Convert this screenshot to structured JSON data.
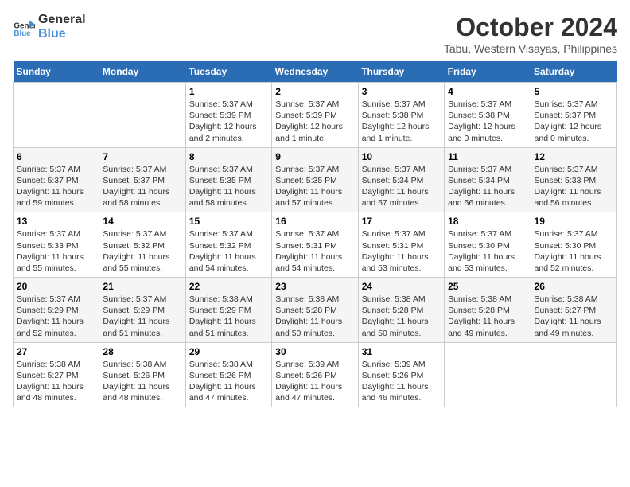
{
  "header": {
    "logo_line1": "General",
    "logo_line2": "Blue",
    "month": "October 2024",
    "location": "Tabu, Western Visayas, Philippines"
  },
  "weekdays": [
    "Sunday",
    "Monday",
    "Tuesday",
    "Wednesday",
    "Thursday",
    "Friday",
    "Saturday"
  ],
  "weeks": [
    [
      {
        "day": "",
        "info": ""
      },
      {
        "day": "",
        "info": ""
      },
      {
        "day": "1",
        "info": "Sunrise: 5:37 AM\nSunset: 5:39 PM\nDaylight: 12 hours and 2 minutes."
      },
      {
        "day": "2",
        "info": "Sunrise: 5:37 AM\nSunset: 5:39 PM\nDaylight: 12 hours and 1 minute."
      },
      {
        "day": "3",
        "info": "Sunrise: 5:37 AM\nSunset: 5:38 PM\nDaylight: 12 hours and 1 minute."
      },
      {
        "day": "4",
        "info": "Sunrise: 5:37 AM\nSunset: 5:38 PM\nDaylight: 12 hours and 0 minutes."
      },
      {
        "day": "5",
        "info": "Sunrise: 5:37 AM\nSunset: 5:37 PM\nDaylight: 12 hours and 0 minutes."
      }
    ],
    [
      {
        "day": "6",
        "info": "Sunrise: 5:37 AM\nSunset: 5:37 PM\nDaylight: 11 hours and 59 minutes."
      },
      {
        "day": "7",
        "info": "Sunrise: 5:37 AM\nSunset: 5:37 PM\nDaylight: 11 hours and 58 minutes."
      },
      {
        "day": "8",
        "info": "Sunrise: 5:37 AM\nSunset: 5:35 PM\nDaylight: 11 hours and 58 minutes."
      },
      {
        "day": "9",
        "info": "Sunrise: 5:37 AM\nSunset: 5:35 PM\nDaylight: 11 hours and 57 minutes."
      },
      {
        "day": "10",
        "info": "Sunrise: 5:37 AM\nSunset: 5:34 PM\nDaylight: 11 hours and 57 minutes."
      },
      {
        "day": "11",
        "info": "Sunrise: 5:37 AM\nSunset: 5:34 PM\nDaylight: 11 hours and 56 minutes."
      },
      {
        "day": "12",
        "info": "Sunrise: 5:37 AM\nSunset: 5:33 PM\nDaylight: 11 hours and 56 minutes."
      }
    ],
    [
      {
        "day": "13",
        "info": "Sunrise: 5:37 AM\nSunset: 5:33 PM\nDaylight: 11 hours and 55 minutes."
      },
      {
        "day": "14",
        "info": "Sunrise: 5:37 AM\nSunset: 5:32 PM\nDaylight: 11 hours and 55 minutes."
      },
      {
        "day": "15",
        "info": "Sunrise: 5:37 AM\nSunset: 5:32 PM\nDaylight: 11 hours and 54 minutes."
      },
      {
        "day": "16",
        "info": "Sunrise: 5:37 AM\nSunset: 5:31 PM\nDaylight: 11 hours and 54 minutes."
      },
      {
        "day": "17",
        "info": "Sunrise: 5:37 AM\nSunset: 5:31 PM\nDaylight: 11 hours and 53 minutes."
      },
      {
        "day": "18",
        "info": "Sunrise: 5:37 AM\nSunset: 5:30 PM\nDaylight: 11 hours and 53 minutes."
      },
      {
        "day": "19",
        "info": "Sunrise: 5:37 AM\nSunset: 5:30 PM\nDaylight: 11 hours and 52 minutes."
      }
    ],
    [
      {
        "day": "20",
        "info": "Sunrise: 5:37 AM\nSunset: 5:29 PM\nDaylight: 11 hours and 52 minutes."
      },
      {
        "day": "21",
        "info": "Sunrise: 5:37 AM\nSunset: 5:29 PM\nDaylight: 11 hours and 51 minutes."
      },
      {
        "day": "22",
        "info": "Sunrise: 5:38 AM\nSunset: 5:29 PM\nDaylight: 11 hours and 51 minutes."
      },
      {
        "day": "23",
        "info": "Sunrise: 5:38 AM\nSunset: 5:28 PM\nDaylight: 11 hours and 50 minutes."
      },
      {
        "day": "24",
        "info": "Sunrise: 5:38 AM\nSunset: 5:28 PM\nDaylight: 11 hours and 50 minutes."
      },
      {
        "day": "25",
        "info": "Sunrise: 5:38 AM\nSunset: 5:28 PM\nDaylight: 11 hours and 49 minutes."
      },
      {
        "day": "26",
        "info": "Sunrise: 5:38 AM\nSunset: 5:27 PM\nDaylight: 11 hours and 49 minutes."
      }
    ],
    [
      {
        "day": "27",
        "info": "Sunrise: 5:38 AM\nSunset: 5:27 PM\nDaylight: 11 hours and 48 minutes."
      },
      {
        "day": "28",
        "info": "Sunrise: 5:38 AM\nSunset: 5:26 PM\nDaylight: 11 hours and 48 minutes."
      },
      {
        "day": "29",
        "info": "Sunrise: 5:38 AM\nSunset: 5:26 PM\nDaylight: 11 hours and 47 minutes."
      },
      {
        "day": "30",
        "info": "Sunrise: 5:39 AM\nSunset: 5:26 PM\nDaylight: 11 hours and 47 minutes."
      },
      {
        "day": "31",
        "info": "Sunrise: 5:39 AM\nSunset: 5:26 PM\nDaylight: 11 hours and 46 minutes."
      },
      {
        "day": "",
        "info": ""
      },
      {
        "day": "",
        "info": ""
      }
    ]
  ]
}
